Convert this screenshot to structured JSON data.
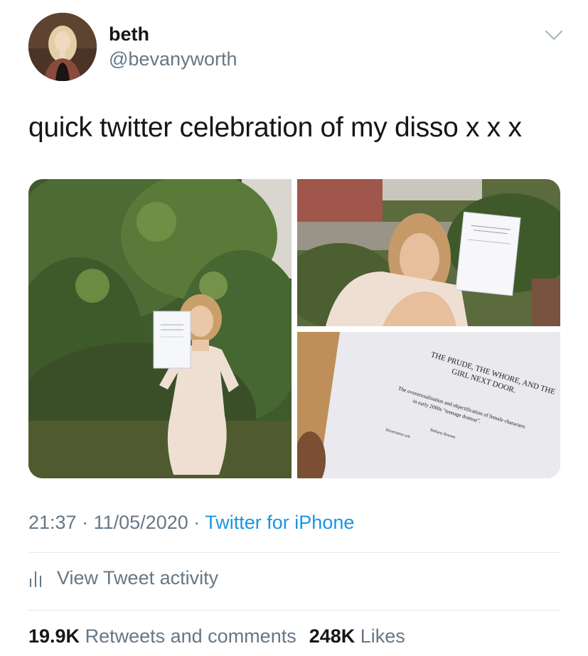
{
  "user": {
    "display_name": "beth",
    "handle": "@bevanyworth"
  },
  "tweet": {
    "text": "quick twitter celebration of my disso x x x",
    "time": "21:37",
    "separator": "·",
    "date": "11/05/2020",
    "source": "Twitter for iPhone"
  },
  "media": {
    "document_title_line1": "THE PRUDE, THE WHORE, AND THE",
    "document_title_line2": "GIRL NEXT DOOR.",
    "document_subtitle_line1": "The oversexualisation and objectification of female characters",
    "document_subtitle_line2": "in early 2000s “teenage dramas”.",
    "document_author": "Bethany Bennett",
    "document_note": "Dissertation sub"
  },
  "activity": {
    "label": "View Tweet activity"
  },
  "stats": {
    "retweets_count": "19.9K",
    "retweets_label": "Retweets and comments",
    "likes_count": "248K",
    "likes_label": "Likes"
  },
  "colors": {
    "text": "#14171a",
    "secondary": "#657786",
    "link": "#1b95e0",
    "divider": "#e1e8ed"
  }
}
